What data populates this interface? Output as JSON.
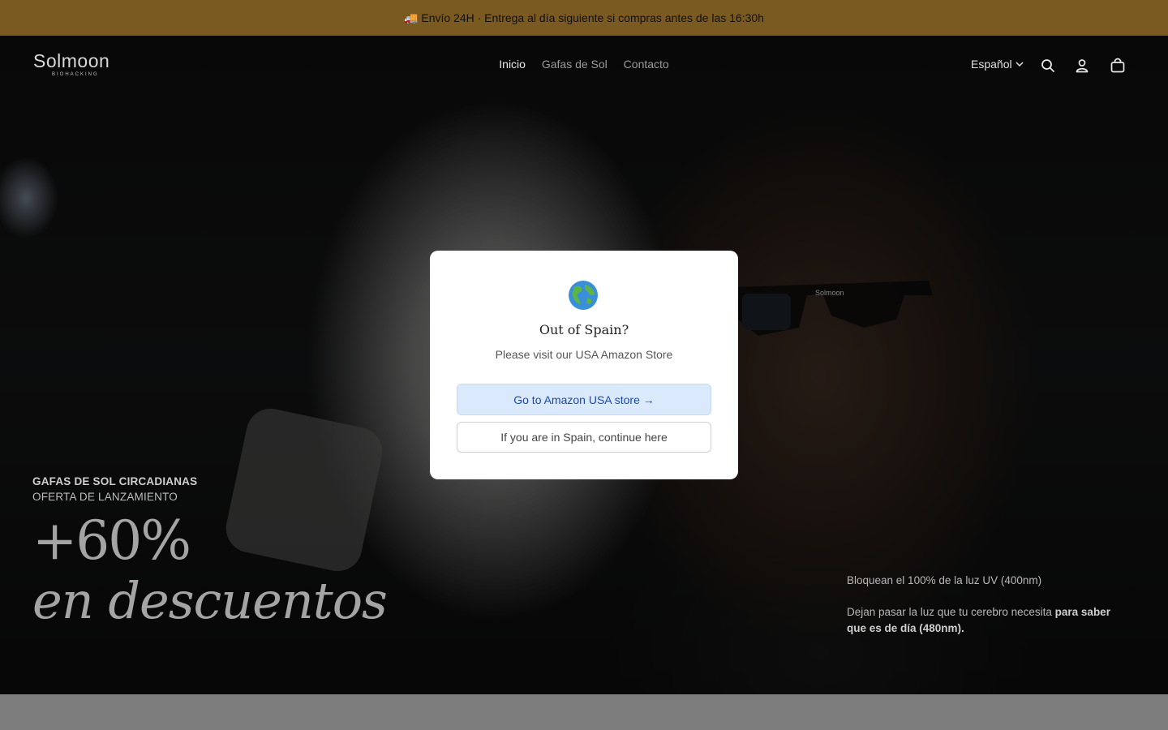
{
  "announcement": {
    "text": "🚚 Envío 24H · Entrega al día siguiente si compras antes de las 16:30h"
  },
  "header": {
    "logo_main": "Solmoon",
    "logo_sub": "BIOHACKING",
    "nav": [
      {
        "label": "Inicio",
        "active": true
      },
      {
        "label": "Gafas de Sol",
        "active": false
      },
      {
        "label": "Contacto",
        "active": false
      }
    ],
    "language": "Español",
    "icons": [
      "search-icon",
      "account-icon",
      "cart-icon"
    ]
  },
  "hero": {
    "eyebrow": "GAFAS DE SOL CIRCADIANAS",
    "eyebrow2": "OFERTA DE LANZAMIENTO",
    "headline": "+60%",
    "headline2": "en descuentos",
    "side_line1": "Bloquean el 100% de la luz UV (400nm)",
    "side_line2_prefix": "Dejan pasar la luz que tu cerebro necesita ",
    "side_line2_bold": "para saber que es de día (480nm).",
    "glasses_brand": "Solmoon"
  },
  "modal": {
    "icon": "globe-icon",
    "title": "Out of Spain?",
    "subtitle": "Please visit our USA Amazon Store",
    "primary_button": "Go to Amazon USA store →",
    "secondary_button": "If you are in Spain, continue here"
  },
  "colors": {
    "announcement_bg": "#7a5a20",
    "primary_button_bg": "#dbe9fd",
    "primary_button_text": "#1a4ab0"
  }
}
